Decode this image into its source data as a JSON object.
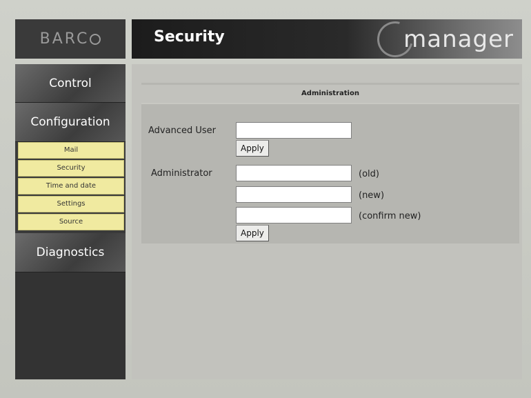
{
  "logo": {
    "text": "BARC",
    "icon": "barco-circle-icon"
  },
  "header": {
    "title": "Security",
    "brand": "manager",
    "brand_icon": "i-swoosh-icon"
  },
  "sidebar": {
    "sections": [
      {
        "label": "Control"
      },
      {
        "label": "Configuration"
      },
      {
        "label": "Diagnostics"
      }
    ],
    "config_items": [
      {
        "label": "Mail"
      },
      {
        "label": "Security"
      },
      {
        "label": "Time and date"
      },
      {
        "label": "Settings"
      },
      {
        "label": "Source"
      }
    ]
  },
  "panel": {
    "title": "Administration",
    "advanced_user": {
      "label": "Advanced User",
      "value": "",
      "apply_label": "Apply"
    },
    "administrator": {
      "label": "Administrator",
      "old_value": "",
      "new_value": "",
      "confirm_value": "",
      "old_hint": "(old)",
      "new_hint": "(new)",
      "confirm_hint": "(confirm new)",
      "apply_label": "Apply"
    }
  },
  "colors": {
    "menu_item_bg": "#f0eaa0",
    "header_bg": "#1c1c1c",
    "sidebar_bg": "#333333"
  }
}
